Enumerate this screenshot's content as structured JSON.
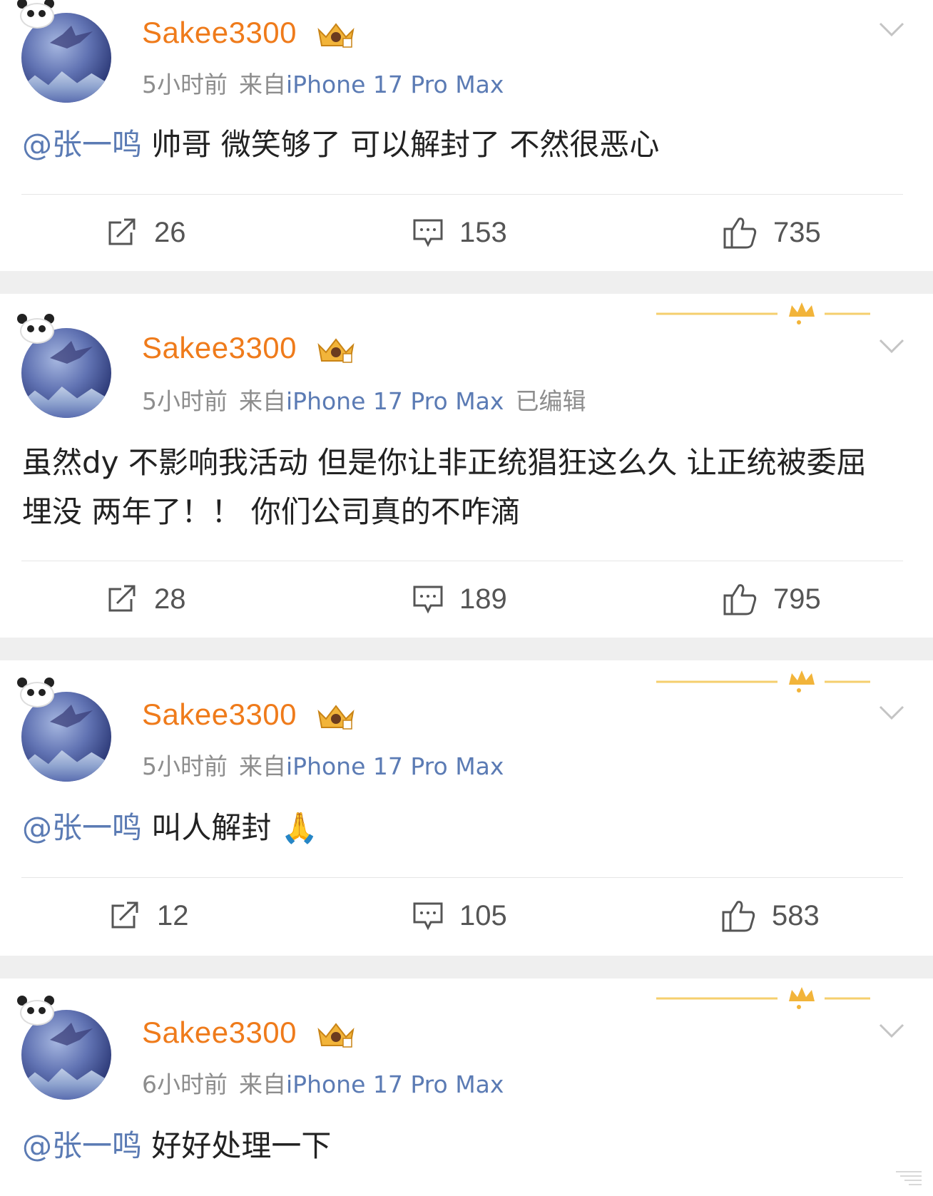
{
  "posts": [
    {
      "username": "Sakee3300",
      "time": "5小时前",
      "source_prefix": "来自",
      "source": "iPhone 17 Pro Max",
      "edited": "",
      "mention": "@张一鸣",
      "text": " 帅哥 微笑够了 可以解封了 不然很恶心",
      "reposts": "26",
      "comments": "153",
      "likes": "735"
    },
    {
      "username": "Sakee3300",
      "time": "5小时前",
      "source_prefix": "来自",
      "source": "iPhone 17 Pro Max",
      "edited": "已编辑",
      "mention": "",
      "text": "虽然dy 不影响我活动 但是你让非正统猖狂这么久 让正统被委屈埋没 两年了！！ 你们公司真的不咋滴",
      "reposts": "28",
      "comments": "189",
      "likes": "795"
    },
    {
      "username": "Sakee3300",
      "time": "5小时前",
      "source_prefix": "来自",
      "source": "iPhone 17 Pro Max",
      "edited": "",
      "mention": "@张一鸣",
      "text": " 叫人解封 🙏",
      "reposts": "12",
      "comments": "105",
      "likes": "583"
    },
    {
      "username": "Sakee3300",
      "time": "6小时前",
      "source_prefix": "来自",
      "source": "iPhone 17 Pro Max",
      "edited": "",
      "mention": "@张一鸣",
      "text": " 好好处理一下",
      "reposts": "",
      "comments": "",
      "likes": ""
    }
  ],
  "icons": {
    "repost": "repost-icon",
    "comment": "comment-icon",
    "like": "thumbs-up-icon",
    "menu": "chevron-down-icon",
    "vip": "vip-crown-icon",
    "decoration": "crown-decoration-icon"
  },
  "colors": {
    "username": "#ef7b1b",
    "link": "#5b7bb4",
    "meta": "#8d8d8d",
    "text": "#222222",
    "separator": "#efefef"
  }
}
